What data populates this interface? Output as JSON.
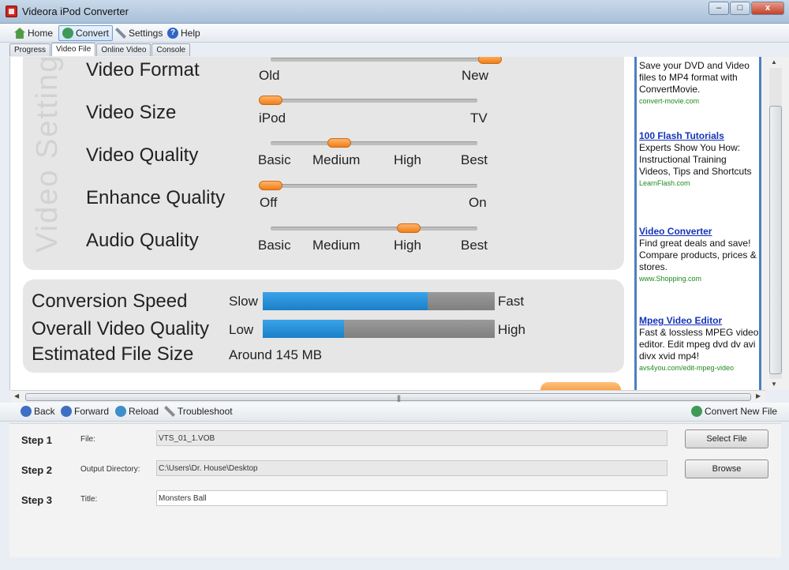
{
  "window": {
    "title": "Videora iPod Converter",
    "minimize": "–",
    "maximize": "□",
    "close": "x"
  },
  "toolbar": {
    "home": "Home",
    "convert": "Convert",
    "settings": "Settings",
    "help": "Help"
  },
  "tabs": [
    "Progress",
    "Video File",
    "Online Video",
    "Console"
  ],
  "settings": {
    "section_label": "Video Settings",
    "video_format": {
      "label": "Video Format",
      "options": [
        "Old",
        "New"
      ],
      "level": 1.0
    },
    "video_size": {
      "label": "Video Size",
      "options": [
        "iPod",
        "TV"
      ],
      "level": 0.0
    },
    "video_quality": {
      "label": "Video Quality",
      "options": [
        "Basic",
        "Medium",
        "High",
        "Best"
      ],
      "level": 0.333
    },
    "enhance_quality": {
      "label": "Enhance Quality",
      "options": [
        "Off",
        "On"
      ],
      "level": 0.0
    },
    "audio_quality": {
      "label": "Audio Quality",
      "options": [
        "Basic",
        "Medium",
        "High",
        "Best"
      ],
      "level": 0.667
    }
  },
  "info": {
    "conversion_speed": {
      "label": "Conversion Speed",
      "min": "Slow",
      "max": "Fast",
      "fill_percent": 71
    },
    "overall_quality": {
      "label": "Overall Video Quality",
      "min": "Low",
      "max": "High",
      "fill_percent": 35
    },
    "file_size": {
      "label": "Estimated File Size",
      "value": "Around 145 MB"
    }
  },
  "ads": [
    {
      "title": "",
      "text": "Save your DVD and Video files to MP4 format with ConvertMovie.",
      "url": "convert-movie.com"
    },
    {
      "title": "100 Flash Tutorials",
      "text": "Experts Show You How: Instructional Training Videos, Tips and Shortcuts",
      "url": "LearnFlash.com"
    },
    {
      "title": "Video Converter",
      "text": "Find great deals and save! Compare products, prices & stores.",
      "url": "www.Shopping.com"
    },
    {
      "title": "Mpeg Video Editor",
      "text": "Fast & lossless MPEG video editor. Edit mpeg dvd dv avi divx xvid mp4!",
      "url": "avs4you.com/edit-mpeg-video"
    }
  ],
  "nav": {
    "back": "Back",
    "forward": "Forward",
    "reload": "Reload",
    "troubleshoot": "Troubleshoot",
    "convert_new": "Convert New File"
  },
  "steps": [
    {
      "step": "Step 1",
      "label": "File:",
      "value": "VTS_01_1.VOB",
      "button": "Select File"
    },
    {
      "step": "Step 2",
      "label": "Output Directory:",
      "value": "C:\\Users\\Dr. House\\Desktop",
      "button": "Browse"
    },
    {
      "step": "Step 3",
      "label": "Title:",
      "value": "Monsters Ball"
    }
  ]
}
